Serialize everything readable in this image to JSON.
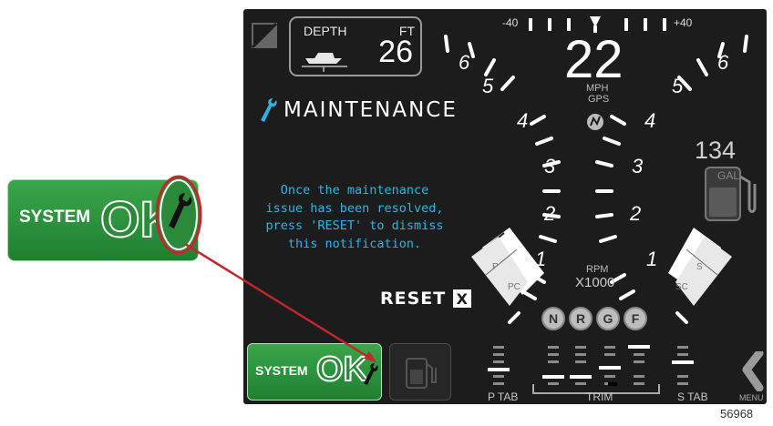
{
  "depth": {
    "label": "DEPTH",
    "unit": "FT",
    "value": "26"
  },
  "maintenance": {
    "title": "MAINTENANCE",
    "message_lines": [
      "Once the maintenance",
      "issue has been resolved,",
      "press 'RESET' to dismiss",
      "this notification."
    ]
  },
  "reset": {
    "label": "RESET",
    "x_label": "X"
  },
  "speed": {
    "value": "22",
    "unit": "MPH",
    "source": "GPS"
  },
  "rpm": {
    "label": "RPM",
    "multiplier": "X1000",
    "left_scale": [
      "6",
      "5",
      "4",
      "3",
      "2",
      "1"
    ],
    "right_scale": [
      "6",
      "5",
      "4",
      "3",
      "2",
      "1"
    ]
  },
  "tab_scale": {
    "left": "-40",
    "right": "+40"
  },
  "trim_zones": {
    "left_top": "P",
    "left_bottom": "PC",
    "right_top": "S",
    "right_bottom": "SC"
  },
  "gears": [
    "N",
    "R",
    "G",
    "F"
  ],
  "fuel": {
    "value": "134",
    "unit": "GAL"
  },
  "status": {
    "system_label": "SYSTEM",
    "ok_label": "OK"
  },
  "bottom": {
    "p_tab": "P TAB",
    "trim": "TRIM",
    "s_tab": "S TAB",
    "menu": "MENU"
  },
  "figure_number": "56968",
  "colors": {
    "accent": "#2fb3e6",
    "status_green": "#2a8a39",
    "callout_red": "#c0282d",
    "background": "#1c1c1c"
  }
}
